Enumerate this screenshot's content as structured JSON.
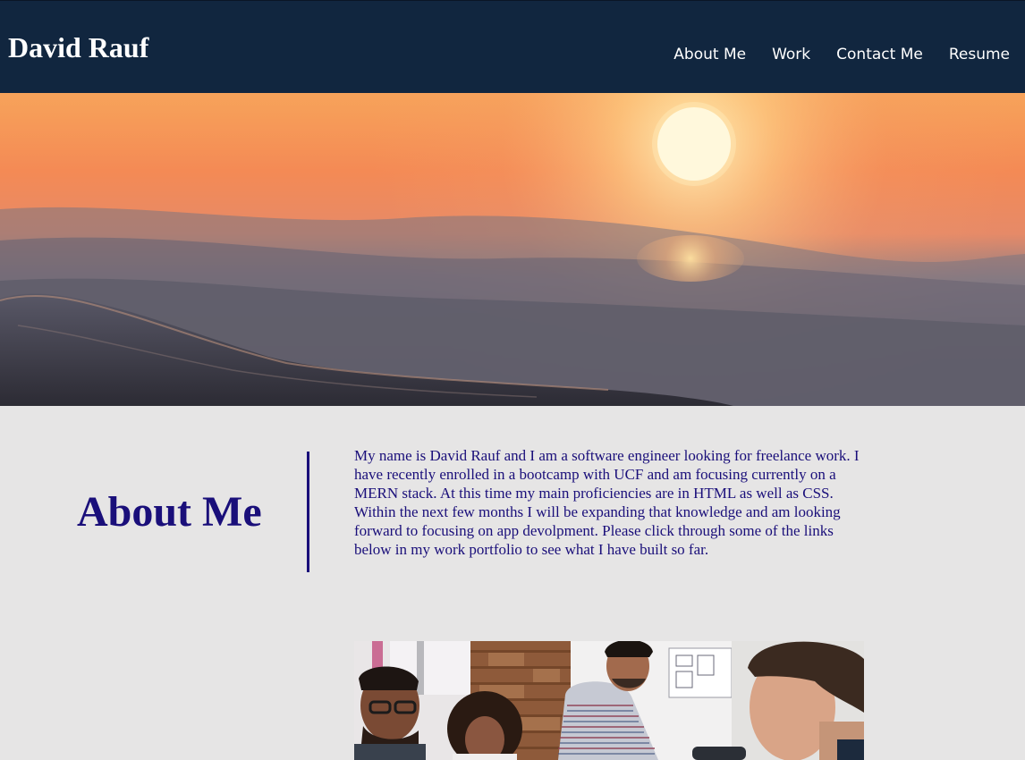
{
  "header": {
    "brand": "David Rauf",
    "nav": [
      "About Me",
      "Work",
      "Contact Me",
      "Resume"
    ],
    "background_color": "#11263f"
  },
  "about": {
    "title": "About Me",
    "body": "My name is David Rauf and I am a software engineer looking for freelance work. I have recently enrolled in a bootcamp with UCF and am focusing currently on a MERN stack. At this time my main proficiencies are in HTML as well as CSS. Within the next few months I will be expanding that knowledge and am looking forward to focusing on app devolpment. Please click through some of the links below in my work portfolio to see what I have built so far.",
    "accent_color": "#1a0f7a"
  },
  "images": {
    "hero": "sunset-over-ocean-waves",
    "work": "team-collaborating-at-table"
  },
  "page_background": "#e6e5e5"
}
